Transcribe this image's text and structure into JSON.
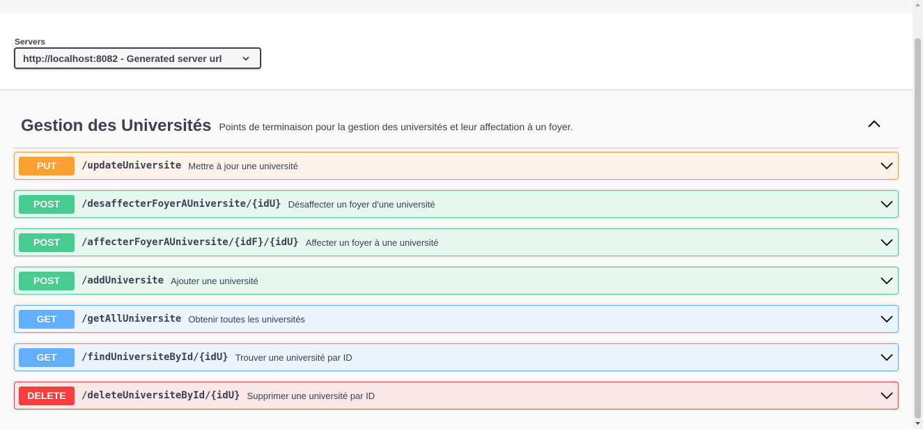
{
  "servers": {
    "label": "Servers",
    "selected": "http://localhost:8082 - Generated server url"
  },
  "tag": {
    "title": "Gestion des Universités",
    "description": "Points de terminaison pour la gestion des universités et leur affectation à un foyer.",
    "expanded": true
  },
  "operations": [
    {
      "method": "PUT",
      "path": "/updateUniversite",
      "summary": "Mettre à jour une université"
    },
    {
      "method": "POST",
      "path": "/desaffecterFoyerAUniversite/{idU}",
      "summary": "Désaffecter un foyer d'une université"
    },
    {
      "method": "POST",
      "path": "/affecterFoyerAUniversite/{idF}/{idU}",
      "summary": "Affecter un foyer à une université"
    },
    {
      "method": "POST",
      "path": "/addUniversite",
      "summary": "Ajouter une université"
    },
    {
      "method": "GET",
      "path": "/getAllUniversite",
      "summary": "Obtenir toutes les universités"
    },
    {
      "method": "GET",
      "path": "/findUniversiteById/{idU}",
      "summary": "Trouver une université par ID"
    },
    {
      "method": "DELETE",
      "path": "/deleteUniversiteById/{idU}",
      "summary": "Supprimer une université par ID"
    }
  ],
  "colors": {
    "put": "#fca130",
    "post": "#49cc90",
    "get": "#61affe",
    "delete": "#f93e3e",
    "text": "#3b4151"
  },
  "icons": {
    "server_select": "chevron-down-icon",
    "tag_toggle": "chevron-up-icon",
    "operation_expand": "chevron-down-icon"
  }
}
